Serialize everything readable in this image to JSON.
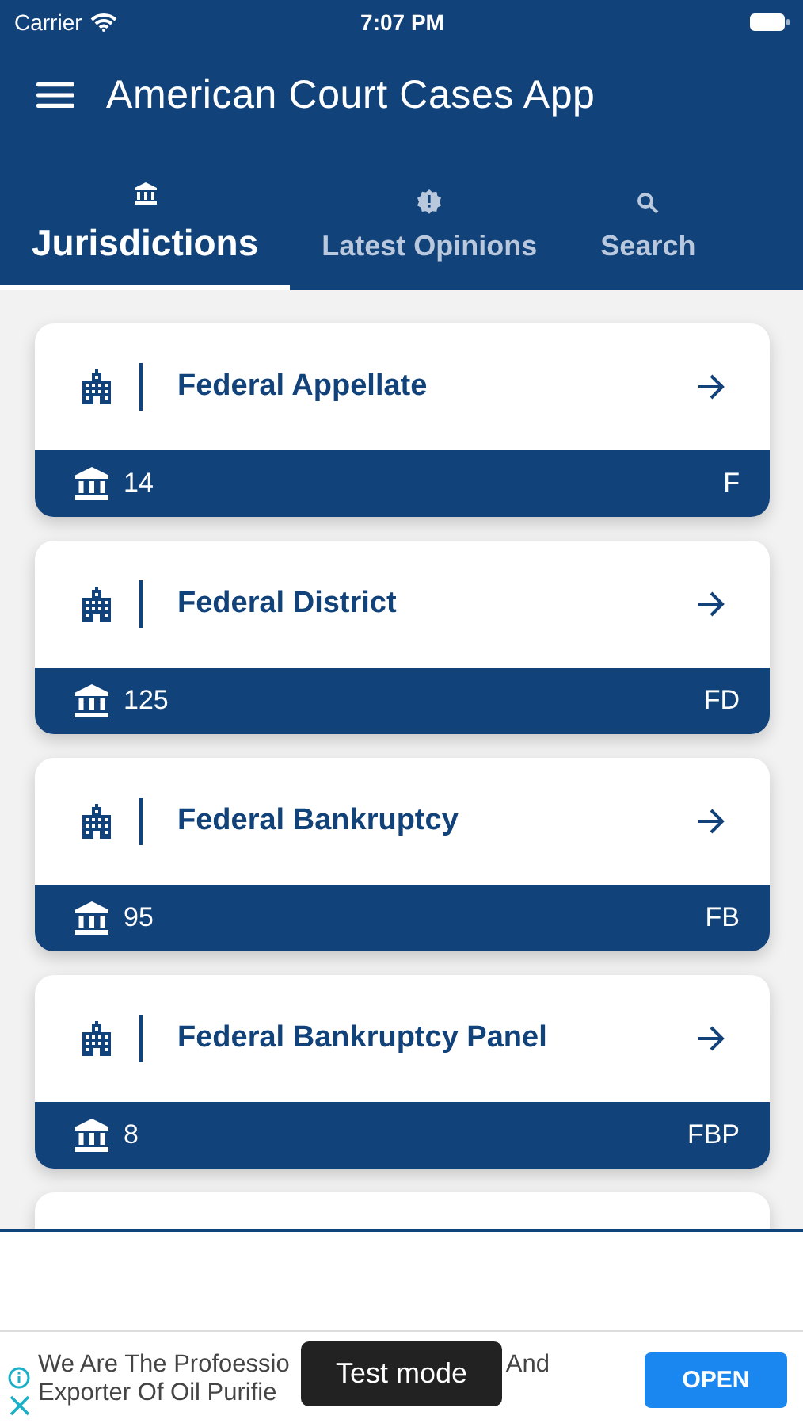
{
  "status_bar": {
    "carrier": "Carrier",
    "time": "7:07 PM"
  },
  "app_bar": {
    "title": "American Court Cases App"
  },
  "tabs": [
    {
      "label": "Jurisdictions",
      "kind": "bank",
      "selected": true
    },
    {
      "label": "Latest Opinions",
      "kind": "alert",
      "selected": false
    },
    {
      "label": "Search",
      "kind": "search",
      "selected": false
    }
  ],
  "jurisdictions": [
    {
      "name": "Federal Appellate",
      "count": "14",
      "code": "F"
    },
    {
      "name": "Federal District",
      "count": "125",
      "code": "FD"
    },
    {
      "name": "Federal Bankruptcy",
      "count": "95",
      "code": "FB"
    },
    {
      "name": "Federal Bankruptcy Panel",
      "count": "8",
      "code": "FBP"
    }
  ],
  "ad": {
    "line_1_start": "We Are The Profoessio",
    "line_1_end": "And",
    "line_2": "Exporter Of Oil Purifie",
    "button": "OPEN",
    "overlay": "Test mode"
  }
}
